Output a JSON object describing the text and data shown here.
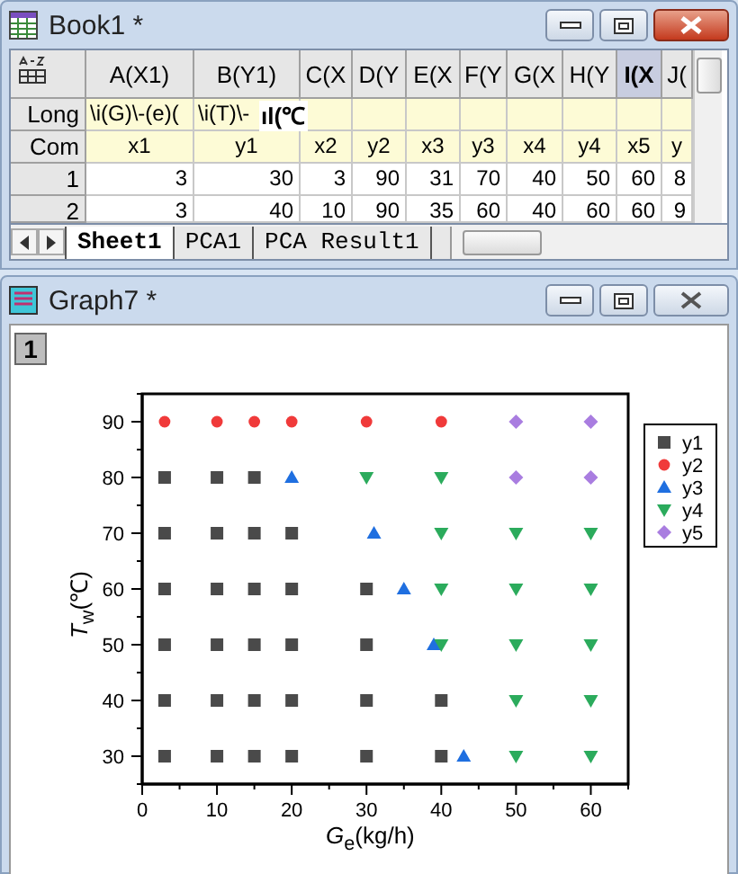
{
  "workbook": {
    "title": "Book1 *",
    "columns": [
      {
        "label": "A(X1)",
        "selected": false
      },
      {
        "label": "B(Y1)",
        "selected": false
      },
      {
        "label": "C(X",
        "selected": false
      },
      {
        "label": "D(Y",
        "selected": false
      },
      {
        "label": "E(X",
        "selected": false
      },
      {
        "label": "F(Y",
        "selected": false
      },
      {
        "label": "G(X",
        "selected": false
      },
      {
        "label": "H(Y",
        "selected": false
      },
      {
        "label": "I(X",
        "selected": true
      },
      {
        "label": "J(",
        "selected": false
      }
    ],
    "rows": [
      {
        "kind": "label",
        "header": "Long",
        "cells": [
          "\\i(G)\\-(e)(",
          "\\i(T)\\-"
        ]
      },
      {
        "kind": "label",
        "header": "Com",
        "cells": [
          "x1",
          "y1",
          "x2",
          "y2",
          "x3",
          "y3",
          "x4",
          "y4",
          "x5",
          "y"
        ]
      },
      {
        "kind": "data",
        "header": "1",
        "cells": [
          "3",
          "30",
          "3",
          "90",
          "31",
          "70",
          "40",
          "50",
          "60",
          "8"
        ]
      },
      {
        "kind": "data",
        "header": "2",
        "cells": [
          "3",
          "40",
          "10",
          "90",
          "35",
          "60",
          "40",
          "60",
          "60",
          "9"
        ]
      }
    ],
    "edit_overlay": "ıl(℃",
    "tabs": [
      {
        "label": "Sheet1",
        "selected": true
      },
      {
        "label": "PCA1",
        "selected": false
      },
      {
        "label": "PCA Result1",
        "selected": false
      }
    ]
  },
  "graph": {
    "title": "Graph7 *",
    "layer": "1",
    "chart_data": {
      "type": "scatter",
      "legend": "right",
      "xlabel": "*G*$_{e}$(kg/h)",
      "ylabel": "*T*$_{w}$(℃)",
      "xlim": [
        0,
        65
      ],
      "ylim": [
        25,
        95
      ],
      "xticks": [
        0,
        10,
        20,
        30,
        40,
        50,
        60
      ],
      "yticks": [
        30,
        40,
        50,
        60,
        70,
        80,
        90
      ],
      "series": [
        {
          "name": "y1",
          "color": "#4a4a4a",
          "x": [
            3,
            3,
            3,
            3,
            3,
            3,
            10,
            10,
            10,
            10,
            10,
            10,
            15,
            15,
            15,
            15,
            15,
            15,
            20,
            20,
            20,
            20,
            20,
            30,
            30,
            30,
            30,
            40,
            40
          ],
          "values": [
            30,
            40,
            50,
            60,
            70,
            80,
            30,
            40,
            50,
            60,
            70,
            80,
            30,
            40,
            50,
            60,
            70,
            80,
            30,
            40,
            50,
            60,
            70,
            30,
            40,
            50,
            60,
            30,
            40
          ]
        },
        {
          "name": "y2",
          "color": "#f03a3a",
          "x": [
            3,
            10,
            15,
            20,
            30,
            40
          ],
          "values": [
            90,
            90,
            90,
            90,
            90,
            90
          ]
        },
        {
          "name": "y3",
          "color": "#1f6fe0",
          "x": [
            20,
            31,
            35,
            39,
            43
          ],
          "values": [
            80,
            70,
            60,
            50,
            30
          ]
        },
        {
          "name": "y4",
          "color": "#2bab5c",
          "x": [
            30,
            40,
            40,
            50,
            60,
            40,
            50,
            60,
            40,
            50,
            60,
            50,
            60,
            50,
            60
          ],
          "values": [
            80,
            80,
            70,
            70,
            70,
            60,
            60,
            60,
            50,
            50,
            50,
            40,
            40,
            30,
            30
          ]
        },
        {
          "name": "y5",
          "color": "#a97de0",
          "x": [
            50,
            60,
            50,
            60
          ],
          "values": [
            90,
            90,
            80,
            80
          ]
        }
      ]
    }
  }
}
